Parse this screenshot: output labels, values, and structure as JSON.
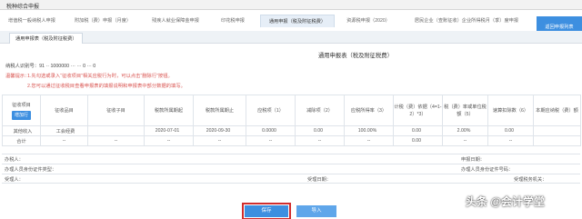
{
  "window": {
    "title": "税种综合申报"
  },
  "tabs": [
    {
      "label": "增值税一般纳税人申报"
    },
    {
      "label": "附加税（费）申报（月度）"
    },
    {
      "label": "残疾人就业保障金申报"
    },
    {
      "label": "印花税申报"
    },
    {
      "label": "通用申报（税及附征税费）"
    },
    {
      "label": "资源税申报（2020）"
    },
    {
      "label": "居民企业（查账征收）企业所得税月（季）度申报"
    }
  ],
  "tab_action": {
    "label": "返回申报列表"
  },
  "subtab": {
    "label": "通用申报表（税及附征税费）"
  },
  "form": {
    "title": "通用申报表（税及附征税费）",
    "taxpayer_label": "纳税人识别号：",
    "taxpayer_value": "91 ·· 1000000 ··· ··· 0 ··· 0",
    "notice_label": "温馨提示：",
    "notice_1": "1.先勾选或录入“征收项目”相关应税行为时，可以点击“删除行”按钮。",
    "notice_2": "2.您可以通过征收税目查看申报表的填报说明和申报表中部分数据的填写。"
  },
  "table": {
    "item_label": "征收项目",
    "add_button": "增加行",
    "headers": [
      "征收品目",
      "征收子目",
      "税款所属期起",
      "税款所属期止",
      "应税项（1）",
      "减除项（2）",
      "应税所得率（3）",
      "计税（费）依据（4=1-2）*3）",
      "税（费）率或单位税额（5）",
      "速算扣除数（6）",
      "本期应纳税（费）额"
    ],
    "rows": [
      {
        "item": "其他收入",
        "sub_item": "工会经费",
        "sub_sub": "",
        "period_start": "2020-07-01",
        "period_end": "2020-09-30",
        "taxable": "0.0000",
        "deduction": "0.00",
        "income_rate": "100.00%",
        "basis": "0.00",
        "rate": "2.00%",
        "quick_deduction": "0.00",
        "payable": ""
      },
      {
        "item": "合计",
        "sub_item": "--",
        "sub_sub": "--",
        "period_start": "--",
        "period_end": "--",
        "taxable": "--",
        "deduction": "--",
        "income_rate": "--",
        "basis": "0.00",
        "rate": "--",
        "quick_deduction": "--",
        "payable": ""
      }
    ]
  },
  "footer": {
    "agent_label": "办税人：",
    "declare_date_label": "申报日期：",
    "agent_id_type_label": "办理人员身份证件类型：",
    "agent_id_no_label": "办理人员身份证件号码：",
    "receiver_label": "受理人：",
    "receive_date_label": "受理日期：",
    "receive_org_label": "受理税务机关："
  },
  "buttons": {
    "save": "保存",
    "import": "导入"
  },
  "watermark": "头条 @会计学堂",
  "colors": {
    "accent": "#3d8fe0",
    "notice": "#d9534f",
    "highlight": "#d12d2d"
  }
}
